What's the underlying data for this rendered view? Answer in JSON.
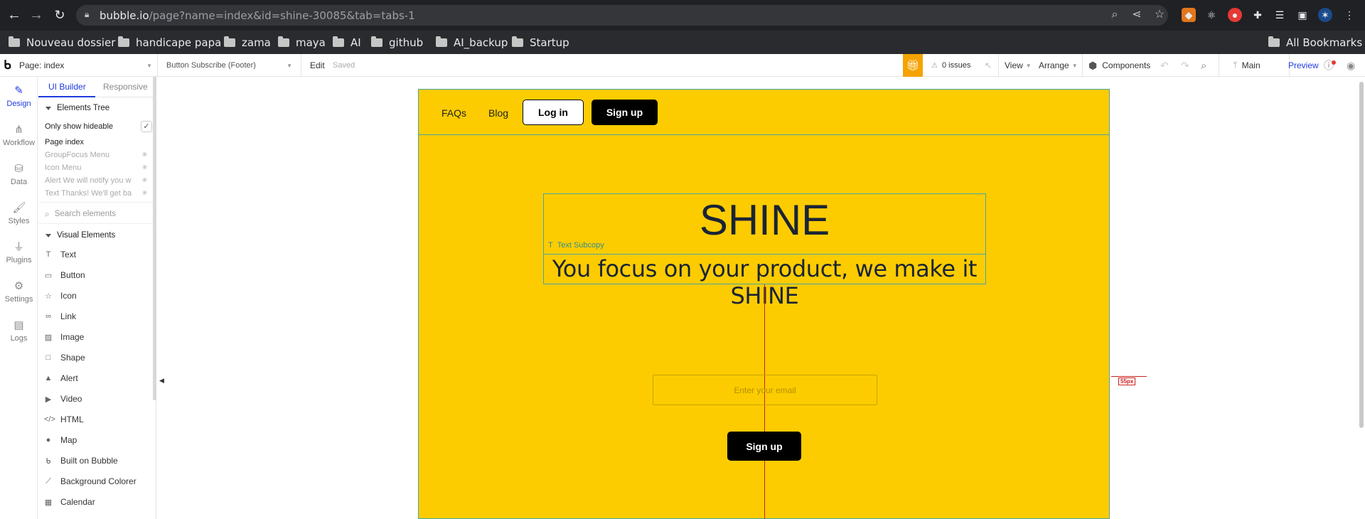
{
  "browser": {
    "url_host": "bubble.io",
    "url_path": "/page?name=index&id=shine-30085&tab=tabs-1",
    "bookmarks": [
      "Nouveau dossier",
      "handicape papa",
      "zama",
      "maya",
      "AI",
      "github",
      "AI_backup",
      "Startup"
    ],
    "all_bookmarks": "All Bookmarks"
  },
  "toolbar": {
    "page_select": "Page: index",
    "element_select": "Button Subscribe (Footer)",
    "edit": "Edit",
    "saved": "Saved",
    "issues": "0 issues",
    "view": "View",
    "arrange": "Arrange",
    "components": "Components",
    "branch": "Main",
    "preview": "Preview"
  },
  "rail": {
    "items": [
      "Design",
      "Workflow",
      "Data",
      "Styles",
      "Plugins",
      "Settings",
      "Logs"
    ]
  },
  "panel": {
    "tab_builder": "UI Builder",
    "tab_responsive": "Responsive",
    "elements_tree": "Elements Tree",
    "only_hideable": "Only show hideable",
    "page_index": "Page index",
    "tree_items": [
      "GroupFocus Menu",
      "Icon Menu",
      "Alert We will notify you w",
      "Text Thanks! We'll get ba"
    ],
    "search_placeholder": "Search elements",
    "visual_elements": "Visual Elements",
    "elements": [
      "Text",
      "Button",
      "Icon",
      "Link",
      "Image",
      "Shape",
      "Alert",
      "Video",
      "HTML",
      "Map",
      "Built on Bubble",
      "Background Colorer",
      "Calendar"
    ]
  },
  "page": {
    "nav": {
      "faqs": "FAQs",
      "blog": "Blog",
      "login": "Log in",
      "signup": "Sign up"
    },
    "title": "SHINE",
    "subcopy_label": "Text Subcopy",
    "subcopy": "You focus on your product, we make it SHINE",
    "spacing_badge": "55px",
    "email_placeholder": "Enter your email",
    "signup_button": "Sign up"
  },
  "colors": {
    "page_bg": "#fdcc00",
    "accent": "#1f3ae0",
    "selection_outline": "#4aa5a5",
    "guide": "#cc2020"
  }
}
